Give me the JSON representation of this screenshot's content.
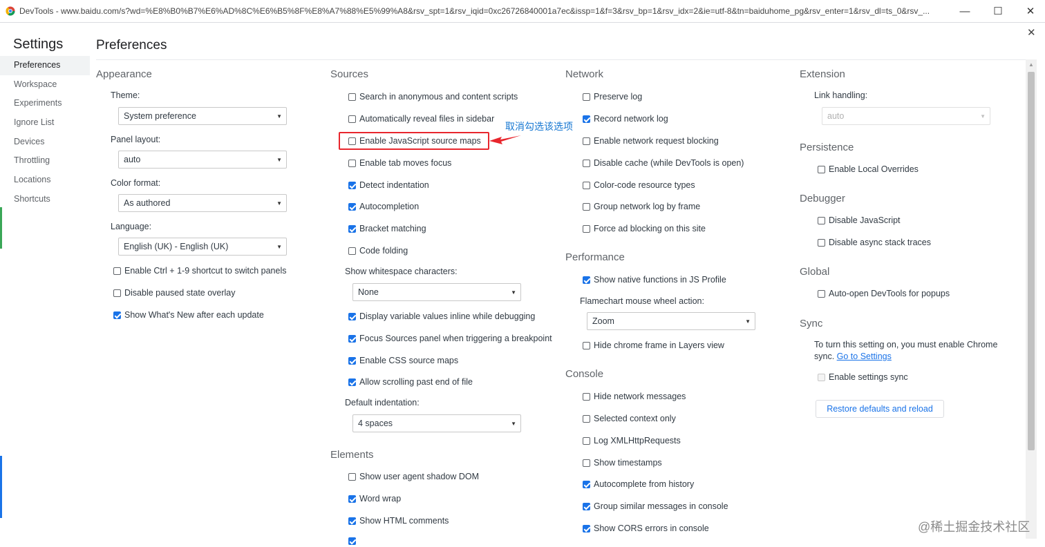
{
  "titlebar": {
    "text": "DevTools - www.baidu.com/s?wd=%E8%B0%B7%E6%AD%8C%E6%B5%8F%E8%A7%88%E5%99%A8&rsv_spt=1&rsv_iqid=0xc26726840001a7ec&issp=1&f=3&rsv_bp=1&rsv_idx=2&ie=utf-8&tn=baiduhome_pg&rsv_enter=1&rsv_dl=ts_0&rsv_..."
  },
  "settings_title": "Settings",
  "page_title": "Preferences",
  "nav": [
    "Preferences",
    "Workspace",
    "Experiments",
    "Ignore List",
    "Devices",
    "Throttling",
    "Locations",
    "Shortcuts"
  ],
  "appearance": {
    "title": "Appearance",
    "theme_label": "Theme:",
    "theme_value": "System preference",
    "panel_label": "Panel layout:",
    "panel_value": "auto",
    "color_label": "Color format:",
    "color_value": "As authored",
    "language_label": "Language:",
    "language_value": "English (UK) - English (UK)",
    "cb1": "Enable Ctrl + 1-9 shortcut to switch panels",
    "cb2": "Disable paused state overlay",
    "cb3": "Show What's New after each update"
  },
  "sources": {
    "title": "Sources",
    "cb1": "Search in anonymous and content scripts",
    "cb2": "Automatically reveal files in sidebar",
    "cb3": "Enable JavaScript source maps",
    "cb4": "Enable tab moves focus",
    "cb5": "Detect indentation",
    "cb6": "Autocompletion",
    "cb7": "Bracket matching",
    "cb8": "Code folding",
    "whitespace_label": "Show whitespace characters:",
    "whitespace_value": "None",
    "cb9": "Display variable values inline while debugging",
    "cb10": "Focus Sources panel when triggering a breakpoint",
    "cb11": "Enable CSS source maps",
    "cb12": "Allow scrolling past end of file",
    "indent_label": "Default indentation:",
    "indent_value": "4 spaces"
  },
  "elements": {
    "title": "Elements",
    "cb1": "Show user agent shadow DOM",
    "cb2": "Word wrap",
    "cb3": "Show HTML comments"
  },
  "network": {
    "title": "Network",
    "cb1": "Preserve log",
    "cb2": "Record network log",
    "cb3": "Enable network request blocking",
    "cb4": "Disable cache (while DevTools is open)",
    "cb5": "Color-code resource types",
    "cb6": "Group network log by frame",
    "cb7": "Force ad blocking on this site"
  },
  "performance": {
    "title": "Performance",
    "cb1": "Show native functions in JS Profile",
    "flame_label": "Flamechart mouse wheel action:",
    "flame_value": "Zoom",
    "cb2": "Hide chrome frame in Layers view"
  },
  "console": {
    "title": "Console",
    "cb1": "Hide network messages",
    "cb2": "Selected context only",
    "cb3": "Log XMLHttpRequests",
    "cb4": "Show timestamps",
    "cb5": "Autocomplete from history",
    "cb6": "Group similar messages in console",
    "cb7": "Show CORS errors in console"
  },
  "extension": {
    "title": "Extension",
    "link_label": "Link handling:",
    "link_value": "auto"
  },
  "persistence": {
    "title": "Persistence",
    "cb1": "Enable Local Overrides"
  },
  "debugger": {
    "title": "Debugger",
    "cb1": "Disable JavaScript",
    "cb2": "Disable async stack traces"
  },
  "global": {
    "title": "Global",
    "cb1": "Auto-open DevTools for popups"
  },
  "sync": {
    "title": "Sync",
    "desc_line1": "To turn this setting on, you must enable Chrome",
    "desc_line2_prefix": "sync. ",
    "desc_link": "Go to Settings",
    "cb1": "Enable settings sync",
    "restore_button": "Restore defaults and reload"
  },
  "annotation": {
    "text": "取消勾选该选项",
    "color": "#e8262d"
  },
  "watermark": "@稀土掘金技术社区",
  "colors": {
    "accent": "#1a73e8",
    "annotation_text": "#1677d2"
  }
}
